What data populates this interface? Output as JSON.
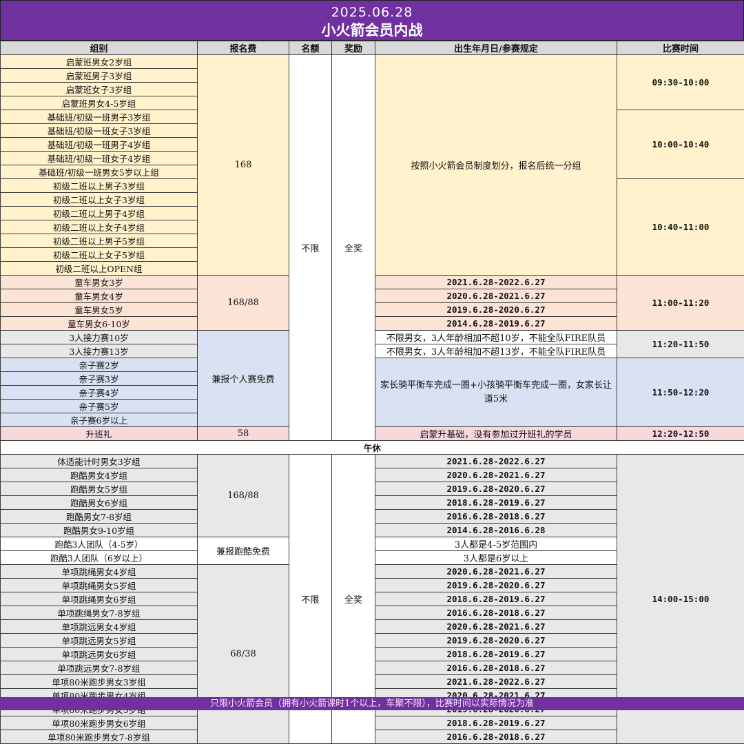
{
  "header": {
    "date": "2025.06.28",
    "title": "小火箭会员内战"
  },
  "columns": [
    "组别",
    "报名费",
    "名额",
    "奖励",
    "出生年月日/参赛规定",
    "比赛时间"
  ],
  "morning": {
    "quota": "不限",
    "award": "全奖",
    "enlight": {
      "fee": "168",
      "rule": "按照小火箭会员制度划分，报名后统一分组",
      "groups": [
        "启蒙班男女2岁组",
        "启蒙班男子3岁组",
        "启蒙班女子3岁组",
        "启蒙班男女4-5岁组",
        "基础班/初级一班男子3岁组",
        "基础班/初级一班女子3岁组",
        "基础班/初级一班男子4岁组",
        "基础班/初级一班女子4岁组",
        "基础班/初级一班男女5岁以上组",
        "初级二班以上男子3岁组",
        "初级二班以上女子3岁组",
        "初级二班以上男子4岁组",
        "初级二班以上女子4岁组",
        "初级二班以上男子5岁组",
        "初级二班以上女子5岁组",
        "初级二班以上OPEN组"
      ],
      "times": [
        "09:30-10:00",
        "10:00-10:40",
        "10:40-11:00"
      ]
    },
    "bike": {
      "fee": "168/88",
      "time": "11:00-11:20",
      "groups": [
        "童车男女3岁",
        "童车男女4岁",
        "童车男女5岁",
        "童车男女6-10岁"
      ],
      "rules": [
        "2021.6.28-2022.6.27",
        "2020.6.28-2021.6.27",
        "2019.6.28-2020.6.27",
        "2014.6.28-2019.6.27"
      ]
    },
    "relay": {
      "fee": "兼报个人赛免费",
      "time": "11:20-11:50",
      "groups": [
        "3人接力赛10岁",
        "3人接力赛13岁"
      ],
      "rules": [
        "不限男女，3人年龄相加不超10岁，不能全队FIRE队员",
        "不限男女，3人年龄相加不超13岁，不能全队FIRE队员"
      ]
    },
    "family": {
      "time": "11:50-12:20",
      "groups": [
        "亲子赛2岁",
        "亲子赛3岁",
        "亲子赛4岁",
        "亲子赛5岁",
        "亲子赛6岁以上"
      ],
      "rule": "家长骑平衡车完成一圈+小孩骑平衡车完成一圈，女家长让道5米"
    },
    "ceremony": {
      "group": "升班礼",
      "fee": "58",
      "rule": "启蒙升基础，没有参加过升班礼的学员",
      "time": "12:20-12:50"
    }
  },
  "rest_label": "午休",
  "afternoon": {
    "quota": "不限",
    "award": "全奖",
    "time": "14:00-15:00",
    "parkour": {
      "fee": "168/88",
      "groups": [
        "体适能计时男女3岁组",
        "跑酷男女4岁组",
        "跑酷男女5岁组",
        "跑酷男女6岁组",
        "跑酷男女7-8岁组",
        "跑酷男女9-10岁组"
      ],
      "rules": [
        "2021.6.28-2022.6.27",
        "2020.6.28-2021.6.27",
        "2019.6.28-2020.6.27",
        "2018.6.28-2019.6.27",
        "2016.6.28-2018.6.27",
        "2014.6.28-2016.6.28"
      ]
    },
    "team": {
      "fee": "兼报跑酷免费",
      "groups": [
        "跑酷3人团队（4-5岁）",
        "跑酷3人团队（6岁以上）"
      ],
      "rules": [
        "3人都是4-5岁范围内",
        "3人都是6岁以上"
      ]
    },
    "single": {
      "fee": "68/38",
      "groups": [
        "单项跳绳男女4岁组",
        "单项跳绳男女5岁组",
        "单项跳绳男女6岁组",
        "单项跳绳男女7-8岁组",
        "单项跳远男女4岁组",
        "单项跳远男女5岁组",
        "单项跳远男女6岁组",
        "单项跳远男女7-8岁组",
        "单项80米跑步男女3岁组",
        "单项80米跑步男女4岁组",
        "单项80米跑步男女5岁组",
        "单项80米跑步男女6岁组",
        "单项80米跑步男女7-8岁组"
      ],
      "rules": [
        "2020.6.28-2021.6.27",
        "2019.6.28-2020.6.27",
        "2018.6.28-2019.6.27",
        "2016.6.28-2018.6.27",
        "2020.6.28-2021.6.27",
        "2019.6.28-2020.6.27",
        "2018.6.28-2019.6.27",
        "2016.6.28-2018.6.27",
        "2021.6.28-2022.6.27",
        "2020.6.28-2021.6.27",
        "2019.6.28-2020.6.27",
        "2018.6.28-2019.6.27",
        "2016.6.28-2018.6.27"
      ]
    }
  },
  "footer": "只限小火箭会员（拥有小火箭课时1个以上，车聚不限），比赛时间以实际情况为准",
  "colors": {
    "banner": "#7030a0",
    "enlight": "#fff2cc",
    "bike": "#fbe4d5",
    "relay": "#d9e1f2",
    "ceremony": "#f8d7dd",
    "afternoon": "#e8e8e8"
  }
}
